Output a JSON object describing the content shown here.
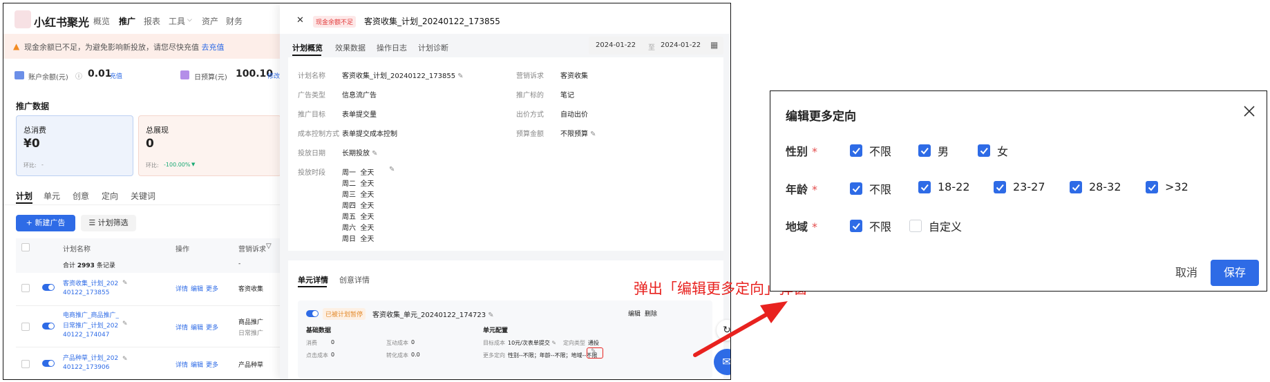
{
  "left_app": {
    "logo_text": "小红书聚光",
    "nav": [
      "概览",
      "推广",
      "报表",
      "工具",
      "资产",
      "财务"
    ],
    "nav_active": "推广",
    "warning": {
      "text": "现金余额已不足，为避免影响新投放，请您尽快充值",
      "link": "去充值"
    },
    "account_balance": {
      "label": "账户余额(元)",
      "value": "0.01",
      "link": "充值"
    },
    "daily_budget": {
      "label": "日预算(元)",
      "value": "100.10",
      "link": "修改"
    },
    "section_title": "推广数据",
    "cards": [
      {
        "label": "总消费",
        "value": "¥0",
        "sub_label": "环比:",
        "sub_value": "-"
      },
      {
        "label": "总展现",
        "value": "0",
        "sub_label": "环比:",
        "sub_value": "-100.00%"
      }
    ],
    "tabs": [
      "计划",
      "单元",
      "创意",
      "定向",
      "关键词"
    ],
    "tab_active": "计划",
    "new_ad_button": "+ 新建广告",
    "filter_button": "计划筛选",
    "table": {
      "headers": [
        "计划名称",
        "操作",
        "营销诉求"
      ],
      "summary": {
        "prefix": "合计",
        "count": "2993",
        "suffix": "条记录",
        "demand": "-"
      },
      "rows": [
        {
          "name_lines": [
            "客资收集_计划_202",
            "40122_173855"
          ],
          "actions": [
            "详情",
            "编辑",
            "更多"
          ],
          "demand": [
            "客资收集"
          ]
        },
        {
          "name_lines": [
            "电商推广_商品推广_",
            "日常推广_计划_202",
            "40122_174047"
          ],
          "actions": [
            "详情",
            "编辑",
            "更多"
          ],
          "demand": [
            "商品推广",
            "日常推广"
          ]
        },
        {
          "name_lines": [
            "产品种草_计划_202",
            "40122_173906"
          ],
          "actions": [
            "详情",
            "编辑",
            "更多"
          ],
          "demand": [
            "产品种草"
          ]
        }
      ]
    }
  },
  "drawer": {
    "badge": "现金余额不足",
    "title": "客资收集_计划_20240122_173855",
    "tabs": [
      "计划概览",
      "效果数据",
      "操作日志",
      "计划诊断"
    ],
    "tab_active": "计划概览",
    "date_start": "2024-01-22",
    "date_sep": "至",
    "date_end": "2024-01-22",
    "info_left": [
      {
        "label": "计划名称",
        "value": "客资收集_计划_20240122_173855",
        "editable": true
      },
      {
        "label": "广告类型",
        "value": "信息流广告"
      },
      {
        "label": "推广目标",
        "value": "表单提交量"
      },
      {
        "label": "成本控制方式",
        "value": "表单提交成本控制"
      },
      {
        "label": "投放日期",
        "value": "长期投放",
        "editable": true
      }
    ],
    "info_right": [
      {
        "label": "营销诉求",
        "value": "客资收集"
      },
      {
        "label": "推广标的",
        "value": "笔记"
      },
      {
        "label": "出价方式",
        "value": "自动出价"
      },
      {
        "label": "预算金额",
        "value": "不限预算",
        "editable": true
      }
    ],
    "schedule_label": "投放时段",
    "schedule": [
      {
        "day": "周一",
        "time": "全天"
      },
      {
        "day": "周二",
        "time": "全天"
      },
      {
        "day": "周三",
        "time": "全天"
      },
      {
        "day": "周四",
        "time": "全天"
      },
      {
        "day": "周五",
        "time": "全天"
      },
      {
        "day": "周六",
        "time": "全天"
      },
      {
        "day": "周日",
        "time": "全天"
      }
    ],
    "unit_tabs": [
      "单元详情",
      "创意详情"
    ],
    "unit_tab_active": "单元详情",
    "unit": {
      "status_badge": "已被计划暂停",
      "name": "客资收集_单元_20240122_174723",
      "actions": [
        "编辑",
        "删除"
      ],
      "basic_title": "基础数据",
      "basic": [
        {
          "label": "消费",
          "value": "0"
        },
        {
          "label": "互动成本",
          "value": "0"
        },
        {
          "label": "点击成本",
          "value": "0"
        },
        {
          "label": "转化成本",
          "value": "0.0"
        }
      ],
      "config_title": "单元配置",
      "config": [
        {
          "label": "目标成本",
          "value": "10元/次表单提交"
        },
        {
          "label": "定向类型",
          "value": "通投"
        },
        {
          "label": "更多定向",
          "value": "性别--不限；年龄--不限；地域--不限"
        }
      ]
    }
  },
  "caption": "弹出「编辑更多定向」弹窗",
  "modal": {
    "title": "编辑更多定向",
    "rows": [
      {
        "label": "性别",
        "required_mark": "*",
        "options": [
          {
            "text": "不限",
            "checked": true
          },
          {
            "text": "男",
            "checked": true
          },
          {
            "text": "女",
            "checked": true
          }
        ]
      },
      {
        "label": "年龄",
        "required_mark": "*",
        "options": [
          {
            "text": "不限",
            "checked": true
          },
          {
            "text": "18-22",
            "checked": true
          },
          {
            "text": "23-27",
            "checked": true
          },
          {
            "text": "28-32",
            "checked": true
          },
          {
            "text": ">32",
            "checked": true
          }
        ]
      },
      {
        "label": "地域",
        "required_mark": "*",
        "options": [
          {
            "text": "不限",
            "checked": true
          },
          {
            "text": "自定义",
            "checked": false
          }
        ]
      }
    ],
    "cancel_label": "取消",
    "save_label": "保存"
  },
  "colors": {
    "primary": "#2e6be6",
    "danger": "#e8221f",
    "warning_bg": "#fdeee9",
    "positive": "#19a974"
  }
}
